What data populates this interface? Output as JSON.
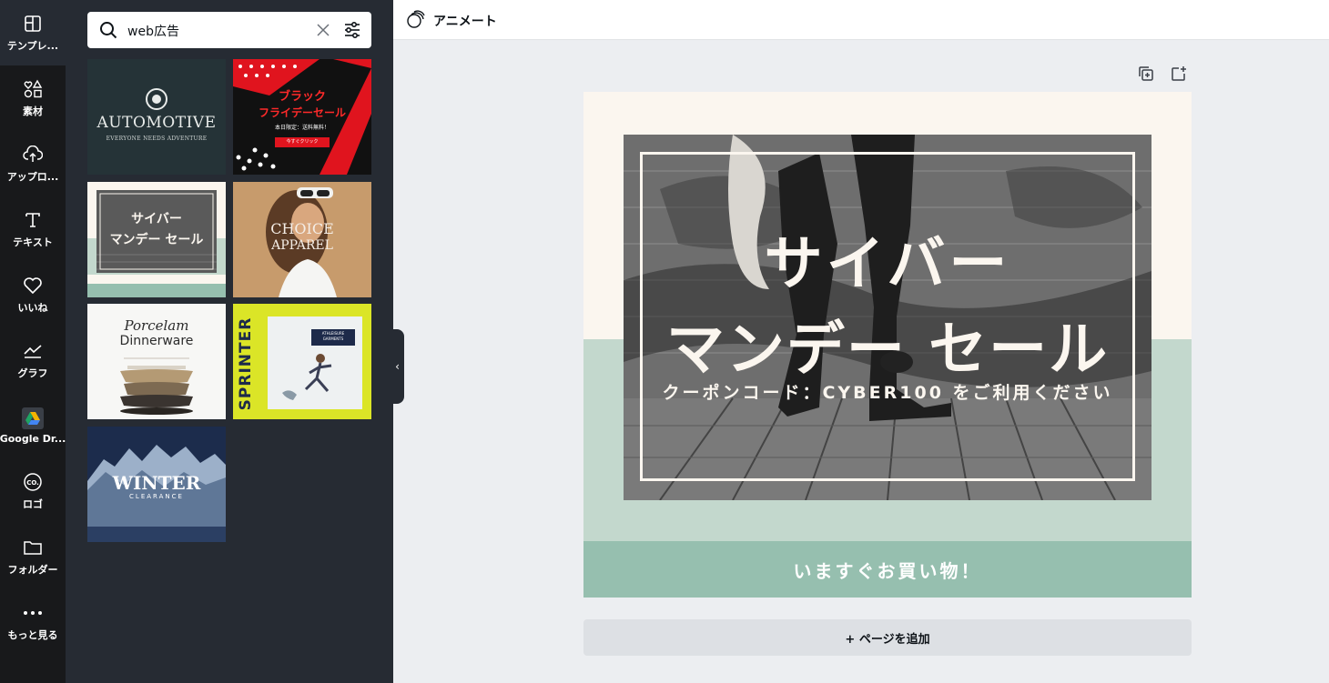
{
  "sidebar": {
    "items": [
      {
        "label": "テンプレ...",
        "icon": "template-icon"
      },
      {
        "label": "素材",
        "icon": "elements-icon"
      },
      {
        "label": "アップロ...",
        "icon": "upload-icon"
      },
      {
        "label": "テキスト",
        "icon": "text-icon"
      },
      {
        "label": "いいね",
        "icon": "heart-icon"
      },
      {
        "label": "グラフ",
        "icon": "chart-icon"
      },
      {
        "label": "Google Dr...",
        "icon": "google-drive-icon"
      },
      {
        "label": "ロゴ",
        "icon": "logo-icon"
      },
      {
        "label": "フォルダー",
        "icon": "folder-icon"
      },
      {
        "label": "もっと見る",
        "icon": "more-icon"
      }
    ]
  },
  "search": {
    "value": "web広告"
  },
  "templates": [
    {
      "title": "AUTOMOTIVE",
      "subtitle": "EVERYONE NEEDS ADVENTURE"
    },
    {
      "title": "ブラック",
      "title2": "フライデーセール",
      "subtitle": "本日限定：送料無料！",
      "button": "今すぐクリック"
    },
    {
      "title": "サイバー",
      "title2": "マンデー セール"
    },
    {
      "title": "CHOICE",
      "title2": "APPAREL"
    },
    {
      "title": "Porcelam",
      "title2": "Dinnerware"
    },
    {
      "title": "SPRINTER",
      "subtitle": "ATHLEISURE GARMENTS"
    },
    {
      "title": "WINTER",
      "subtitle": "CLEARANCE"
    }
  ],
  "topbar": {
    "animate_label": "アニメート"
  },
  "design": {
    "headline_line1": "サイバー",
    "headline_line2": "マンデー セール",
    "coupon": "クーポンコード：CYBER100 をご利用ください",
    "cta": "いますぐお買い物！",
    "colors": {
      "cream": "#fbf6ef",
      "mint": "#c3d8cd",
      "cta": "#96bfaf"
    }
  },
  "canvas": {
    "add_page_label": "+ ページを追加"
  }
}
